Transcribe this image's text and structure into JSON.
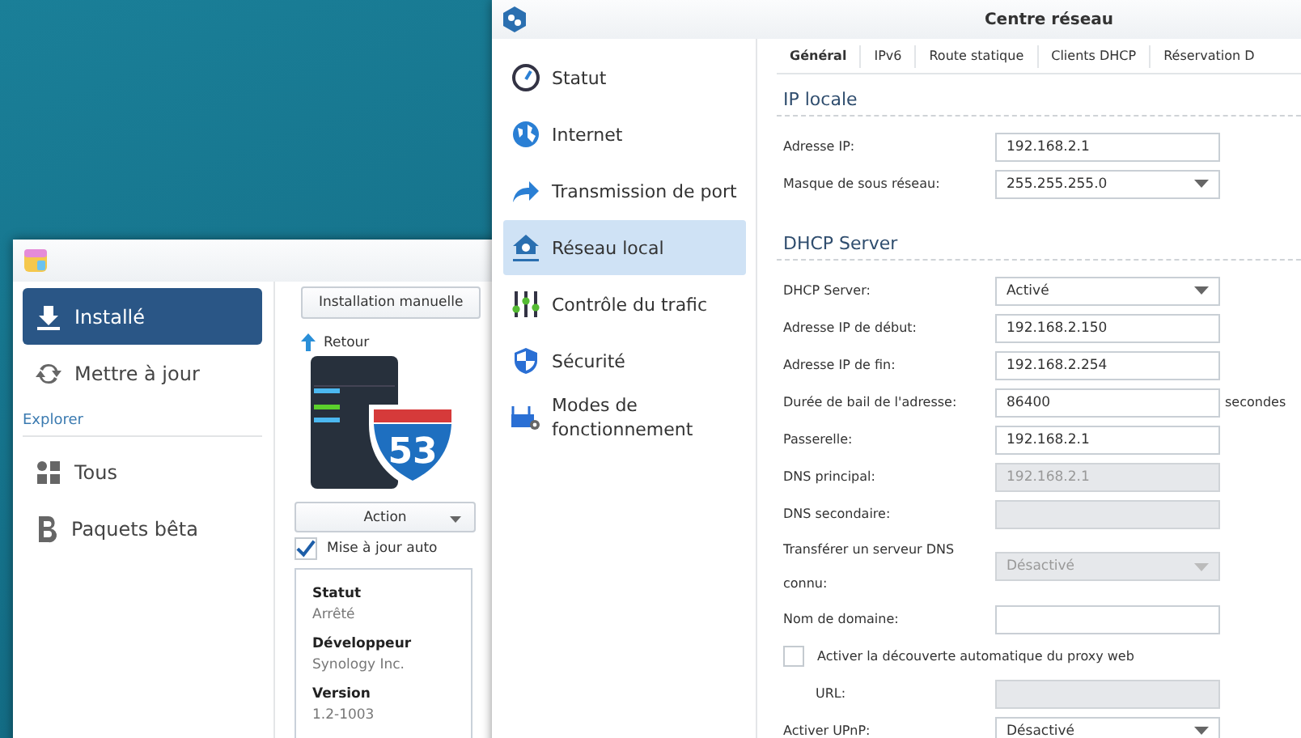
{
  "package_window": {
    "sidebar": {
      "items": [
        {
          "label": "Installé",
          "selected": true
        },
        {
          "label": "Mettre à jour",
          "selected": false
        }
      ],
      "section": "Explorer",
      "section_items": [
        {
          "label": "Tous",
          "selected": false
        },
        {
          "label": "Paquets bêta",
          "selected": false
        }
      ]
    },
    "app_badge": "53",
    "toolbar": {
      "buttons": [
        "Installation manuelle"
      ]
    },
    "back_link": "Retour",
    "action_button": "Action",
    "auto_update": {
      "label": "Mise à jour auto",
      "checked": true
    },
    "info": [
      {
        "title": "Statut",
        "value": "Arrêté"
      },
      {
        "title": "Développeur",
        "value": "Synology Inc."
      },
      {
        "title": "Version",
        "value": "1.2-1003"
      }
    ]
  },
  "network_window": {
    "title": "Centre réseau",
    "sidebar": {
      "items": [
        {
          "label": "Statut",
          "selected": false
        },
        {
          "label": "Internet",
          "selected": false
        },
        {
          "label": "Transmission de port",
          "selected": false
        },
        {
          "label": "Réseau local",
          "selected": true
        },
        {
          "label": "Contrôle du trafic",
          "selected": false
        },
        {
          "label": "Sécurité",
          "selected": false
        },
        {
          "label": "Modes de fonctionnement",
          "selected": false
        }
      ]
    },
    "tabs": [
      {
        "label": "Général",
        "selected": true
      },
      {
        "label": "IPv6",
        "selected": false
      },
      {
        "label": "Route statique",
        "selected": false
      },
      {
        "label": "Clients DHCP",
        "selected": false
      },
      {
        "label": "Réservation D",
        "selected": false
      }
    ],
    "sections": [
      {
        "title": "IP locale",
        "fields": [
          {
            "kind": "input",
            "label": "Adresse IP:",
            "value": "192.168.2.1",
            "disabled": false
          },
          {
            "kind": "select",
            "label": "Masque de sous réseau:",
            "value": "255.255.255.0",
            "disabled": false
          }
        ]
      },
      {
        "title": "DHCP Server",
        "fields": [
          {
            "kind": "select",
            "label": "DHCP Server:",
            "value": "Activé",
            "disabled": false
          },
          {
            "kind": "input",
            "label": "Adresse IP de début:",
            "value": "192.168.2.150",
            "disabled": false
          },
          {
            "kind": "input",
            "label": "Adresse IP de fin:",
            "value": "192.168.2.254",
            "disabled": false
          },
          {
            "kind": "input",
            "label": "Durée de bail de l'adresse:",
            "value": "86400",
            "disabled": false,
            "suffix": "secondes"
          },
          {
            "kind": "input",
            "label": "Passerelle:",
            "value": "192.168.2.1",
            "disabled": false
          },
          {
            "kind": "input",
            "label": "DNS principal:",
            "value": "192.168.2.1",
            "disabled": true
          },
          {
            "kind": "input",
            "label": "DNS secondaire:",
            "disabled": true
          },
          {
            "kind": "select",
            "label": "Transférer un serveur DNS connu:",
            "value": "Désactivé",
            "disabled": true
          },
          {
            "kind": "input",
            "label": "Nom de domaine:",
            "disabled": false
          },
          {
            "kind": "checkbox",
            "label": "Activer la découverte automatique du proxy web",
            "checked": false
          },
          {
            "kind": "sub_input",
            "label": "URL:",
            "disabled": true
          },
          {
            "kind": "select",
            "label": "Activer UPnP:",
            "value": "Désactivé",
            "disabled": false
          }
        ]
      }
    ]
  }
}
